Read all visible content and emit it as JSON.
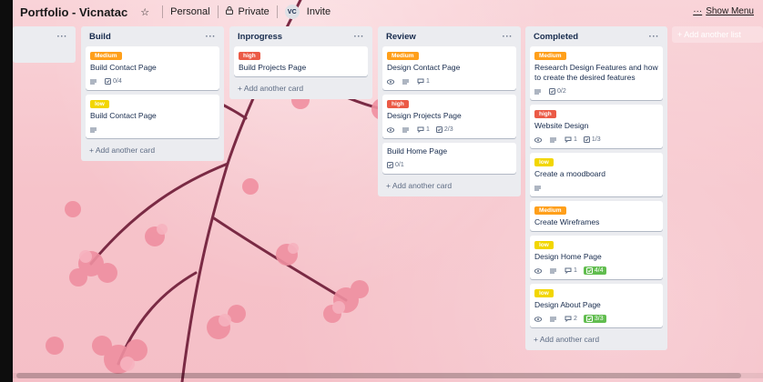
{
  "header": {
    "board_title": "Portfolio - Vicnatac",
    "visibility_team": "Personal",
    "visibility_privacy": "Private",
    "avatar_initials": "VC",
    "invite_label": "Invite",
    "show_menu_label": "Show Menu",
    "dots": "···"
  },
  "colors": {
    "label_medium": "#ff9f1a",
    "label_high": "#eb5a46",
    "label_low": "#f2d600",
    "checklist_done": "#61bd4f",
    "list_bg": "#ebecf0"
  },
  "lists": {
    "partial": {
      "menu": "···"
    },
    "build": {
      "title": "Build",
      "menu": "···",
      "cards": [
        {
          "label": "Medium",
          "title": "Build Contact Page",
          "checklist": "0/4"
        },
        {
          "label": "low",
          "title": "Build Contact Page"
        }
      ],
      "add_card": "+ Add another card"
    },
    "inprogress": {
      "title": "Inprogress",
      "menu": "···",
      "cards": [
        {
          "label": "high",
          "title": "Build Projects Page"
        }
      ],
      "add_card": "+ Add another card"
    },
    "review": {
      "title": "Review",
      "menu": "···",
      "cards": [
        {
          "label": "Medium",
          "title": "Design Contact Page",
          "comments": "1"
        },
        {
          "label": "high",
          "title": "Design Projects Page",
          "comments": "1",
          "checklist": "2/3"
        },
        {
          "title": "Build Home Page",
          "checklist": "0/1"
        }
      ],
      "add_card": "+ Add another card"
    },
    "completed": {
      "title": "Completed",
      "menu": "···",
      "cards": [
        {
          "label": "Medium",
          "title": "Research Design Features and how to create the desired features",
          "checklist": "0/2"
        },
        {
          "label": "high",
          "title": "Website Design",
          "comments": "1",
          "checklist": "1/3"
        },
        {
          "label": "low",
          "title": "Create a moodboard"
        },
        {
          "label": "Medium",
          "title": "Create Wireframes"
        },
        {
          "label": "low",
          "title": "Design Home Page",
          "comments": "1",
          "checklist": "4/4"
        },
        {
          "label": "low",
          "title": "Design About Page",
          "comments": "2",
          "checklist": "3/3"
        }
      ],
      "add_card": "+ Add another card"
    }
  },
  "add_list_label": "+ Add another list"
}
